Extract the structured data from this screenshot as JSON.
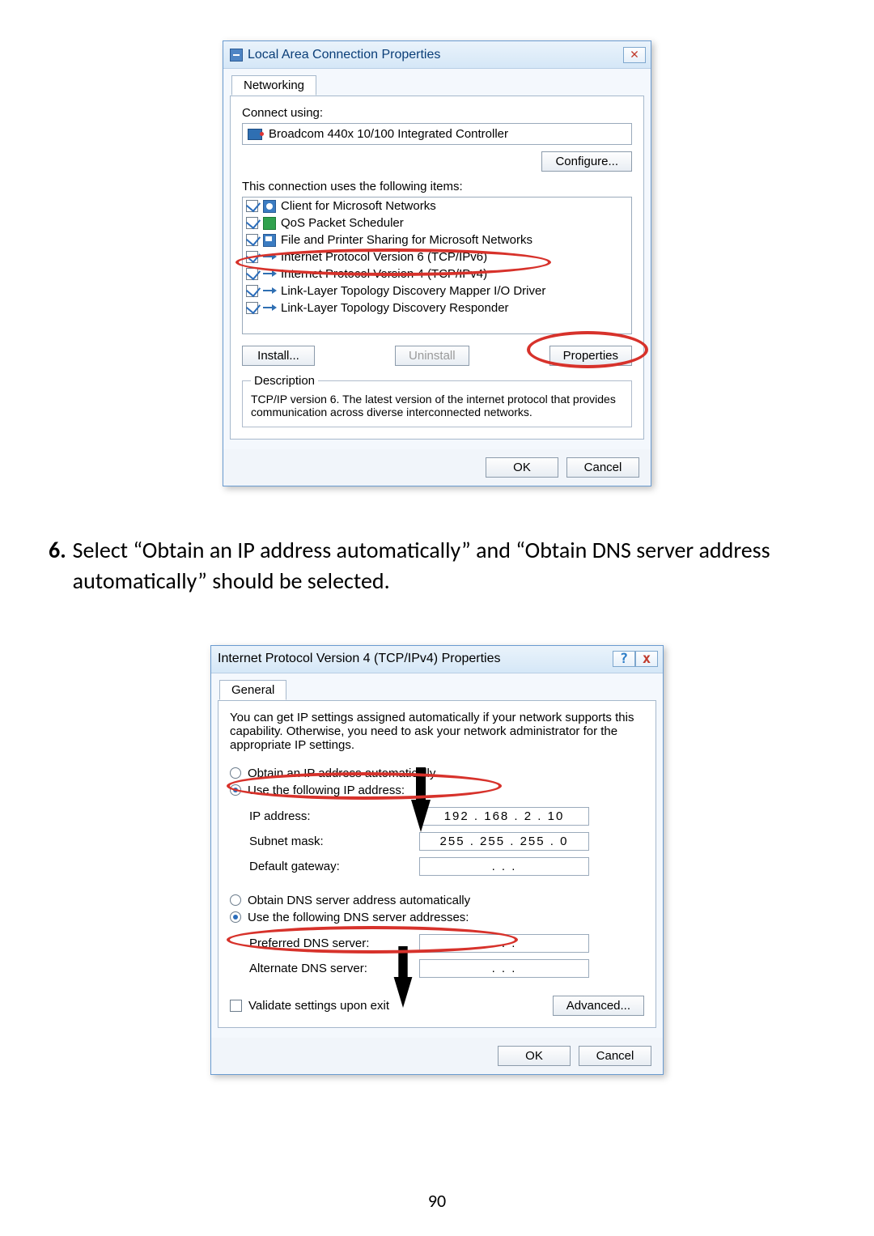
{
  "dialog1": {
    "title": "Local Area Connection Properties",
    "tab": "Networking",
    "connect_using_label": "Connect using:",
    "adapter": "Broadcom 440x 10/100 Integrated Controller",
    "configure_btn": "Configure...",
    "items_label": "This connection uses the following items:",
    "items": [
      {
        "label": "Client for Microsoft Networks",
        "checked": true,
        "icon": "icon-client"
      },
      {
        "label": "QoS Packet Scheduler",
        "checked": true,
        "icon": "icon-sched"
      },
      {
        "label": "File and Printer Sharing for Microsoft Networks",
        "checked": true,
        "icon": "icon-share"
      },
      {
        "label": "Internet Protocol Version 6 (TCP/IPv6)",
        "checked": true,
        "icon": "icon-proto"
      },
      {
        "label": "Internet Protocol Version 4 (TCP/IPv4)",
        "checked": true,
        "icon": "icon-proto"
      },
      {
        "label": "Link-Layer Topology Discovery Mapper I/O Driver",
        "checked": true,
        "icon": "icon-proto"
      },
      {
        "label": "Link-Layer Topology Discovery Responder",
        "checked": true,
        "icon": "icon-proto"
      }
    ],
    "install_btn": "Install...",
    "uninstall_btn": "Uninstall",
    "properties_btn": "Properties",
    "desc_heading": "Description",
    "desc_text": "TCP/IP version 6. The latest version of the internet protocol that provides communication across diverse interconnected networks.",
    "ok_btn": "OK",
    "cancel_btn": "Cancel"
  },
  "step6": {
    "num": "6.",
    "text": "Select “Obtain an IP address automatically” and “Obtain DNS server address automatically” should be selected."
  },
  "dialog2": {
    "title": "Internet Protocol Version 4 (TCP/IPv4) Properties",
    "help_glyph": "?",
    "close_glyph": "x",
    "tab": "General",
    "intro": "You can get IP settings assigned automatically if your network supports this capability. Otherwise, you need to ask your network administrator for the appropriate IP settings.",
    "radio_obtain_ip": "Obtain an IP address automatically",
    "radio_use_ip": "Use the following IP address:",
    "ip_label": "IP address:",
    "ip_value": "192 . 168 .  2  . 10",
    "subnet_label": "Subnet mask:",
    "subnet_value": "255 . 255 . 255 .  0",
    "gateway_label": "Default gateway:",
    "gateway_value": ".        .        .",
    "radio_obtain_dns": "Obtain DNS server address automatically",
    "radio_use_dns": "Use the following DNS server addresses:",
    "preferred_label": "Preferred DNS server:",
    "preferred_value": ".        .        .",
    "alternate_label": "Alternate DNS server:",
    "alternate_value": ".        .        .",
    "validate_label": "Validate settings upon exit",
    "advanced_btn": "Advanced...",
    "ok_btn": "OK",
    "cancel_btn": "Cancel"
  },
  "page_number": "90"
}
